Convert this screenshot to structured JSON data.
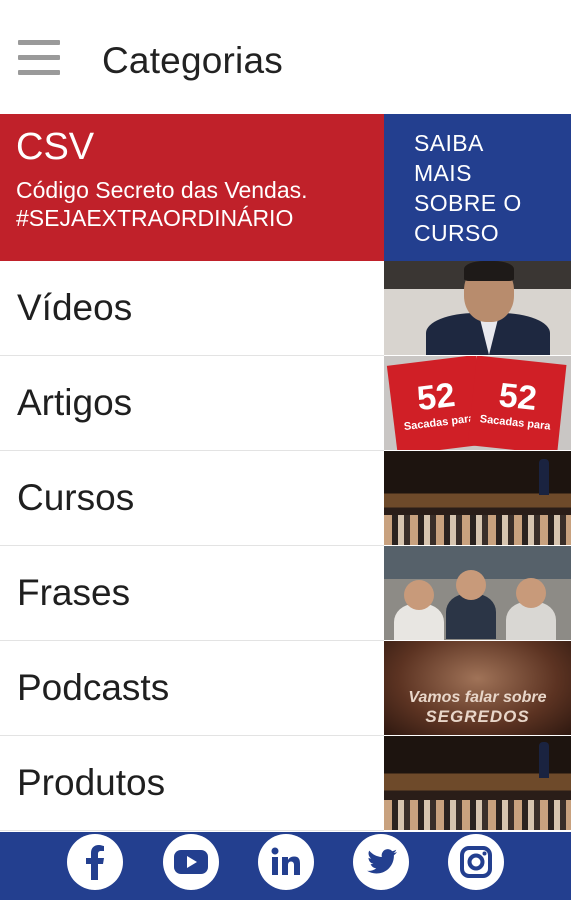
{
  "header": {
    "title": "Categorias",
    "menu_icon": "hamburger-menu-icon"
  },
  "banner": {
    "title": "CSV",
    "subtitle_line1": "Código Secreto das Vendas.",
    "subtitle_line2": "#SEJAEXTRAORDINÁRIO",
    "cta_line1": "SAIBA",
    "cta_line2": "MAIS",
    "cta_line3": "SOBRE O",
    "cta_line4": "CURSO",
    "left_color": "#c0212a",
    "right_color": "#233f8f"
  },
  "categories": [
    {
      "label": "Vídeos"
    },
    {
      "label": "Artigos"
    },
    {
      "label": "Cursos"
    },
    {
      "label": "Frases"
    },
    {
      "label": "Podcasts"
    },
    {
      "label": "Produtos"
    }
  ],
  "thumbnails": {
    "book_number": "52",
    "book_caption": "Sacadas para",
    "segredos_line1": "Vamos falar sobre",
    "segredos_line2": "SEGREDOS"
  },
  "social": {
    "bar_color": "#233f8f",
    "icons": [
      "facebook-icon",
      "youtube-icon",
      "linkedin-icon",
      "twitter-icon",
      "instagram-icon"
    ]
  }
}
